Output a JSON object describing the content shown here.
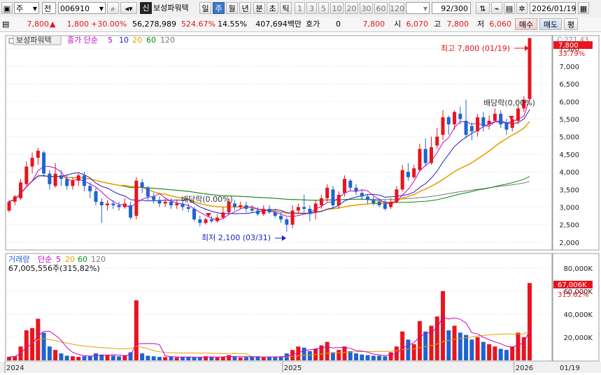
{
  "toolbar": {
    "market_label": "주",
    "mode_label": "전",
    "code": "006910",
    "search_icon": "magnifier-icon",
    "sound_icon": "speaker-icon",
    "new_badge": "신",
    "stock_name": "보성파워텍",
    "period_day": "일",
    "period_week": "주",
    "period_month": "월",
    "period_year": "년",
    "period_min": "분",
    "period_sec": "초",
    "period_tick": "틱",
    "intervals": [
      "1",
      "3",
      "5",
      "10",
      "20",
      "30",
      "60",
      "120"
    ],
    "count": "92",
    "count_total": "/300",
    "date": "2026/01/19",
    "calendar_icon": "calendar-icon",
    "save_icon": "floppy-icon",
    "settings_icon": "gear-icon"
  },
  "info": {
    "price": "7,800",
    "up_icon": "up-arrow-icon",
    "change": "1,800",
    "change_pct": "+30.00%",
    "volume": "56,278,989",
    "vol_ratio": "524.67%",
    "turnover": "14.55%",
    "amount": "407,694백만",
    "quote_label": "호가",
    "quote_value": "0",
    "current": "7,800",
    "open_label": "시",
    "open": "6,070",
    "high_label": "고",
    "high": "7,800",
    "low_label": "저",
    "low": "6,060",
    "buy": "매수",
    "sell": "매도",
    "flat": "평"
  },
  "legend": {
    "stock_name": "보성파워텍",
    "ma_label": "종가 단순",
    "ma_periods": [
      "5",
      "10",
      "20",
      "60",
      "120"
    ],
    "ma_colors": [
      "#c800c8",
      "#1e1ec8",
      "#e6a000",
      "#0a8c0a",
      "#787878"
    ],
    "vol_label": "거래량",
    "vol_ma_label": "단순",
    "vol_value": "67,005,556주(315,82%)"
  },
  "annotations": {
    "high_text": "최고 7,800 (01/19)",
    "low_text": "최저 2,100 (03/31)",
    "div1": "배당락(0.00%)",
    "div2": "배당락(0,00%)"
  },
  "scale": {
    "top_label": "C:271.43",
    "price_box": "7,800",
    "pct_box": "33.79%",
    "vol_box": "67,006K",
    "vol_pct_box": "315.82%"
  },
  "colors": {
    "up": "#e8141e",
    "down": "#1e64d2",
    "ma5": "#c800c8",
    "ma10": "#1e1ec8",
    "ma20": "#e6a000",
    "ma60": "#0a8c0a",
    "ma120": "#787878"
  },
  "chart_data": {
    "type": "candlestick",
    "title": "보성파워텍 (006910) 주봉",
    "x_labels": [
      "2024",
      "2025",
      "2026",
      "01/19"
    ],
    "y_ticks": [
      "2,000",
      "2,500",
      "3,000",
      "3,500",
      "4,000",
      "4,500",
      "5,000",
      "5,500",
      "6,000",
      "6,500",
      "7,000",
      "7,500"
    ],
    "ylim": [
      1800,
      7850
    ],
    "vol_ticks": [
      "20,000K",
      "40,000K",
      "60,000K",
      "80,000K"
    ],
    "vol_ylim": [
      0,
      92000
    ],
    "candles": [
      [
        2900,
        3150,
        3200,
        2850
      ],
      [
        3150,
        3300,
        3350,
        3050
      ],
      [
        3250,
        3700,
        3800,
        3200
      ],
      [
        3650,
        4150,
        4300,
        3600
      ],
      [
        4150,
        4400,
        4550,
        3950
      ],
      [
        4400,
        4600,
        4680,
        4200
      ],
      [
        4550,
        3950,
        4600,
        3850
      ],
      [
        3950,
        3650,
        4050,
        3500
      ],
      [
        3600,
        3950,
        4250,
        3550
      ],
      [
        3900,
        3800,
        4050,
        3600
      ],
      [
        3800,
        3600,
        3900,
        3500
      ],
      [
        3600,
        3750,
        3850,
        3500
      ],
      [
        3750,
        3900,
        3950,
        3600
      ],
      [
        3900,
        3600,
        4000,
        3450
      ],
      [
        3600,
        3450,
        3700,
        3250
      ],
      [
        3450,
        3150,
        3550,
        3050
      ],
      [
        3150,
        3050,
        3250,
        2550
      ],
      [
        3050,
        3100,
        3200,
        2900
      ],
      [
        3100,
        3050,
        3200,
        2950
      ],
      [
        3050,
        3000,
        3150,
        2900
      ],
      [
        3000,
        3100,
        3250,
        2950
      ],
      [
        3050,
        2700,
        3150,
        2650
      ],
      [
        2750,
        3750,
        3850,
        2650
      ],
      [
        3700,
        3550,
        3800,
        3400
      ],
      [
        3550,
        3300,
        3600,
        3200
      ],
      [
        3300,
        3200,
        3400,
        3100
      ],
      [
        3200,
        3100,
        3300,
        3000
      ],
      [
        3100,
        3150,
        3250,
        3000
      ],
      [
        3150,
        3050,
        3250,
        2950
      ],
      [
        3050,
        3100,
        3200,
        2950
      ],
      [
        3100,
        3000,
        3200,
        2900
      ],
      [
        3000,
        2950,
        3100,
        2850
      ],
      [
        2950,
        2650,
        3000,
        2600
      ],
      [
        2650,
        2550,
        2750,
        2450
      ],
      [
        2550,
        2650,
        2700,
        2500
      ],
      [
        2650,
        2600,
        2750,
        2550
      ],
      [
        2600,
        2700,
        2800,
        2550
      ],
      [
        2700,
        2850,
        3000,
        2650
      ],
      [
        2850,
        3150,
        3250,
        2800
      ],
      [
        3100,
        3000,
        3200,
        2900
      ],
      [
        3000,
        3050,
        3150,
        2950
      ],
      [
        3050,
        2950,
        3150,
        2850
      ],
      [
        2950,
        2900,
        3050,
        2850
      ],
      [
        2900,
        2800,
        3000,
        2750
      ],
      [
        2800,
        2950,
        3050,
        2750
      ],
      [
        2950,
        2850,
        3050,
        2800
      ],
      [
        2850,
        2750,
        2950,
        2700
      ],
      [
        2750,
        2650,
        2850,
        2550
      ],
      [
        2650,
        2500,
        2700,
        2300
      ],
      [
        2500,
        2900,
        3050,
        2400
      ],
      [
        2900,
        3000,
        3100,
        2800
      ],
      [
        3000,
        2950,
        3350,
        2850
      ],
      [
        2950,
        2800,
        3050,
        2600
      ],
      [
        2850,
        3100,
        3200,
        2650
      ],
      [
        3050,
        3250,
        3350,
        2950
      ],
      [
        3250,
        3550,
        3650,
        3150
      ],
      [
        3500,
        3050,
        3600,
        2950
      ],
      [
        3050,
        3350,
        3450,
        2950
      ],
      [
        3400,
        3800,
        3900,
        3300
      ],
      [
        3750,
        3550,
        3800,
        3450
      ],
      [
        3550,
        3450,
        3650,
        3350
      ],
      [
        3400,
        3300,
        3500,
        3200
      ],
      [
        3300,
        3200,
        3350,
        3100
      ],
      [
        3200,
        3100,
        3300,
        3050
      ],
      [
        3150,
        3050,
        3250,
        3000
      ],
      [
        3100,
        2950,
        3200,
        2900
      ],
      [
        3000,
        3150,
        3250,
        2950
      ],
      [
        3150,
        3500,
        3600,
        3100
      ],
      [
        3500,
        4050,
        4200,
        3450
      ],
      [
        4000,
        3850,
        4250,
        3750
      ],
      [
        3850,
        4100,
        4200,
        3800
      ],
      [
        4050,
        4650,
        4800,
        4000
      ],
      [
        4650,
        4250,
        4950,
        4150
      ],
      [
        4250,
        4700,
        5000,
        4200
      ],
      [
        4750,
        5000,
        5250,
        4650
      ],
      [
        5050,
        5550,
        5750,
        4900
      ],
      [
        5550,
        5350,
        5600,
        5050
      ],
      [
        5350,
        5700,
        5750,
        5200
      ],
      [
        5650,
        5500,
        5850,
        5350
      ],
      [
        5450,
        5050,
        6050,
        4950
      ],
      [
        5300,
        5150,
        5400,
        4900
      ],
      [
        5150,
        5550,
        5650,
        5000
      ],
      [
        5550,
        5300,
        5700,
        5150
      ],
      [
        5350,
        5450,
        5600,
        5200
      ],
      [
        5450,
        5650,
        5800,
        5400
      ],
      [
        5650,
        5350,
        5750,
        5250
      ],
      [
        5400,
        5200,
        5500,
        5050
      ],
      [
        5250,
        5500,
        5550,
        5150
      ],
      [
        5450,
        5800,
        5900,
        5350
      ],
      [
        5800,
        6050,
        6150,
        5700
      ],
      [
        6070,
        7800,
        7800,
        6060
      ]
    ],
    "volume_k": [
      3000,
      3500,
      12000,
      26000,
      28000,
      36000,
      24000,
      12000,
      9000,
      6000,
      4000,
      3500,
      3000,
      3500,
      4000,
      6000,
      5000,
      4500,
      4000,
      3500,
      4000,
      7000,
      52000,
      6000,
      4000,
      3500,
      3000,
      2800,
      3000,
      2500,
      2800,
      3000,
      2500,
      2800,
      3500,
      3000,
      2500,
      3200,
      4500,
      3000,
      2500,
      2800,
      3000,
      3500,
      2500,
      3000,
      2800,
      3500,
      6000,
      9000,
      12000,
      11000,
      8000,
      10000,
      13000,
      16000,
      7000,
      9000,
      12000,
      8000,
      6000,
      5000,
      4500,
      4000,
      4000,
      3500,
      7000,
      12000,
      25000,
      18000,
      14000,
      34000,
      25000,
      30000,
      38000,
      60000,
      26000,
      30000,
      24000,
      22000,
      18000,
      20000,
      16000,
      14000,
      12000,
      10000,
      9000,
      12000,
      24000,
      20000,
      67006
    ]
  }
}
